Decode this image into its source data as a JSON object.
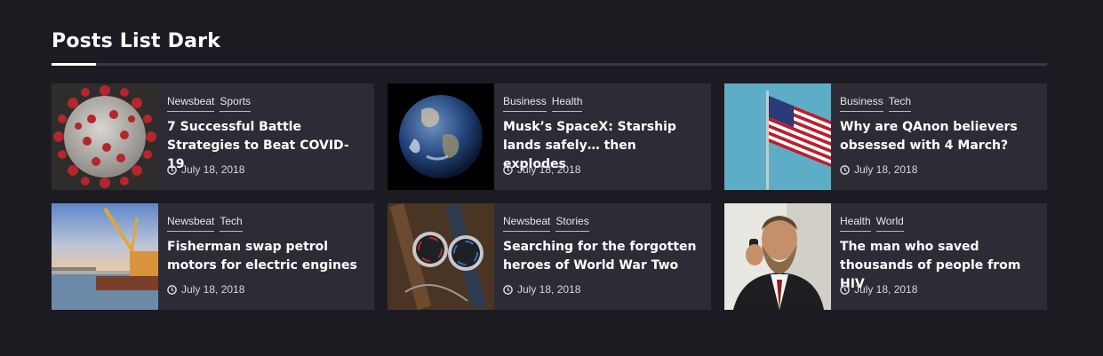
{
  "section": {
    "title": "Posts List Dark"
  },
  "posts": [
    {
      "categories": [
        "Newsbeat",
        "Sports"
      ],
      "title": "7 Successful Battle Strategies to Beat COVID-19",
      "date": "July 18, 2018",
      "image": "coronavirus-image"
    },
    {
      "categories": [
        "Business",
        "Health"
      ],
      "title": "Musk’s SpaceX: Starship lands safely… then explodes",
      "date": "July 18, 2018",
      "image": "earth-image"
    },
    {
      "categories": [
        "Business",
        "Tech"
      ],
      "title": "Why are QAnon believers obsessed with 4 March?",
      "date": "July 18, 2018",
      "image": "us-flag-image"
    },
    {
      "categories": [
        "Newsbeat",
        "Tech"
      ],
      "title": "Fisherman swap petrol motors for electric engines",
      "date": "July 18, 2018",
      "image": "fishing-boat-image"
    },
    {
      "categories": [
        "Newsbeat",
        "Stories"
      ],
      "title": "Searching for the forgotten heroes of World War Two",
      "date": "July 18, 2018",
      "image": "wristwatches-image"
    },
    {
      "categories": [
        "Health",
        "World"
      ],
      "title": "The man who saved thousands of people from HIV",
      "date": "July 18, 2018",
      "image": "bearded-man-image"
    }
  ],
  "icons": {
    "date": "clock-icon"
  }
}
